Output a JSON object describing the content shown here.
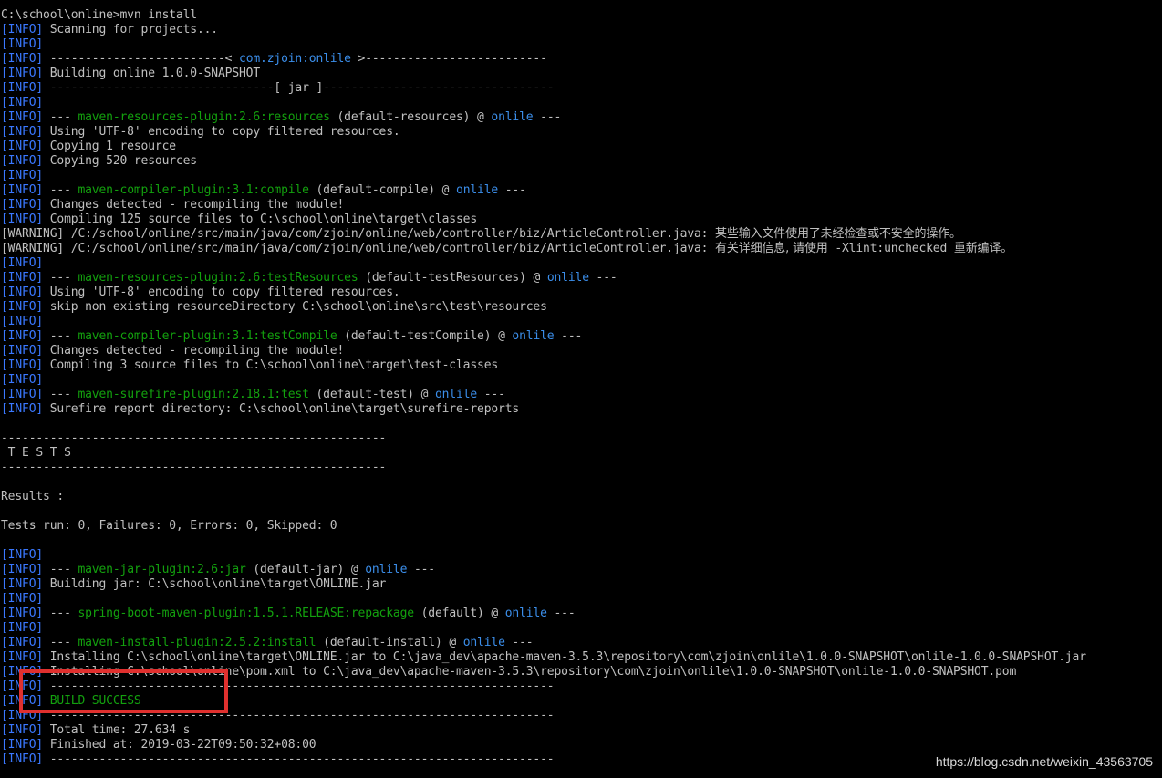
{
  "terminal": {
    "lines": [
      [
        {
          "t": "C:\\school\\online>mvn install",
          "c": "white"
        }
      ],
      [
        {
          "t": "[INFO]",
          "c": "info"
        },
        {
          "t": " Scanning for projects...",
          "c": "white"
        }
      ],
      [
        {
          "t": "[INFO]",
          "c": "info"
        }
      ],
      [
        {
          "t": "[INFO]",
          "c": "info"
        },
        {
          "t": " -------------------------< ",
          "c": "white"
        },
        {
          "t": "com.zjoin:onlile",
          "c": "blue"
        },
        {
          "t": " >--------------------------",
          "c": "white"
        }
      ],
      [
        {
          "t": "[INFO]",
          "c": "info"
        },
        {
          "t": " Building online 1.0.0-SNAPSHOT",
          "c": "white"
        }
      ],
      [
        {
          "t": "[INFO]",
          "c": "info"
        },
        {
          "t": " --------------------------------[ jar ]---------------------------------",
          "c": "white"
        }
      ],
      [
        {
          "t": "[INFO]",
          "c": "info"
        }
      ],
      [
        {
          "t": "[INFO]",
          "c": "info"
        },
        {
          "t": " --- ",
          "c": "white"
        },
        {
          "t": "maven-resources-plugin:2.6:resources",
          "c": "green"
        },
        {
          "t": " (default-resources) @ ",
          "c": "white"
        },
        {
          "t": "onlile",
          "c": "blue"
        },
        {
          "t": " ---",
          "c": "white"
        }
      ],
      [
        {
          "t": "[INFO]",
          "c": "info"
        },
        {
          "t": " Using 'UTF-8' encoding to copy filtered resources.",
          "c": "white"
        }
      ],
      [
        {
          "t": "[INFO]",
          "c": "info"
        },
        {
          "t": " Copying 1 resource",
          "c": "white"
        }
      ],
      [
        {
          "t": "[INFO]",
          "c": "info"
        },
        {
          "t": " Copying 520 resources",
          "c": "white"
        }
      ],
      [
        {
          "t": "[INFO]",
          "c": "info"
        }
      ],
      [
        {
          "t": "[INFO]",
          "c": "info"
        },
        {
          "t": " --- ",
          "c": "white"
        },
        {
          "t": "maven-compiler-plugin:3.1:compile",
          "c": "green"
        },
        {
          "t": " (default-compile) @ ",
          "c": "white"
        },
        {
          "t": "onlile",
          "c": "blue"
        },
        {
          "t": " ---",
          "c": "white"
        }
      ],
      [
        {
          "t": "[INFO]",
          "c": "info"
        },
        {
          "t": " Changes detected - recompiling the module!",
          "c": "white"
        }
      ],
      [
        {
          "t": "[INFO]",
          "c": "info"
        },
        {
          "t": " Compiling 125 source files to C:\\school\\online\\target\\classes",
          "c": "white"
        }
      ],
      [
        {
          "t": "[WARNING]",
          "c": "warn"
        },
        {
          "t": " /C:/school/online/src/main/java/com/zjoin/online/web/controller/biz/ArticleController.java: ",
          "c": "white"
        },
        {
          "t": "某些输入文件使用了未经检查或不安全的操作。",
          "c": "cjk"
        }
      ],
      [
        {
          "t": "[WARNING]",
          "c": "warn"
        },
        {
          "t": " /C:/school/online/src/main/java/com/zjoin/online/web/controller/biz/ArticleController.java: ",
          "c": "white"
        },
        {
          "t": "有关详细信息, 请使用",
          "c": "cjk"
        },
        {
          "t": " -Xlint:unchecked ",
          "c": "white"
        },
        {
          "t": "重新编译。",
          "c": "cjk"
        }
      ],
      [
        {
          "t": "[INFO]",
          "c": "info"
        }
      ],
      [
        {
          "t": "[INFO]",
          "c": "info"
        },
        {
          "t": " --- ",
          "c": "white"
        },
        {
          "t": "maven-resources-plugin:2.6:testResources",
          "c": "green"
        },
        {
          "t": " (default-testResources) @ ",
          "c": "white"
        },
        {
          "t": "onlile",
          "c": "blue"
        },
        {
          "t": " ---",
          "c": "white"
        }
      ],
      [
        {
          "t": "[INFO]",
          "c": "info"
        },
        {
          "t": " Using 'UTF-8' encoding to copy filtered resources.",
          "c": "white"
        }
      ],
      [
        {
          "t": "[INFO]",
          "c": "info"
        },
        {
          "t": " skip non existing resourceDirectory C:\\school\\online\\src\\test\\resources",
          "c": "white"
        }
      ],
      [
        {
          "t": "[INFO]",
          "c": "info"
        }
      ],
      [
        {
          "t": "[INFO]",
          "c": "info"
        },
        {
          "t": " --- ",
          "c": "white"
        },
        {
          "t": "maven-compiler-plugin:3.1:testCompile",
          "c": "green"
        },
        {
          "t": " (default-testCompile) @ ",
          "c": "white"
        },
        {
          "t": "onlile",
          "c": "blue"
        },
        {
          "t": " ---",
          "c": "white"
        }
      ],
      [
        {
          "t": "[INFO]",
          "c": "info"
        },
        {
          "t": " Changes detected - recompiling the module!",
          "c": "white"
        }
      ],
      [
        {
          "t": "[INFO]",
          "c": "info"
        },
        {
          "t": " Compiling 3 source files to C:\\school\\online\\target\\test-classes",
          "c": "white"
        }
      ],
      [
        {
          "t": "[INFO]",
          "c": "info"
        }
      ],
      [
        {
          "t": "[INFO]",
          "c": "info"
        },
        {
          "t": " --- ",
          "c": "white"
        },
        {
          "t": "maven-surefire-plugin:2.18.1:test",
          "c": "green"
        },
        {
          "t": " (default-test) @ ",
          "c": "white"
        },
        {
          "t": "onlile",
          "c": "blue"
        },
        {
          "t": " ---",
          "c": "white"
        }
      ],
      [
        {
          "t": "[INFO]",
          "c": "info"
        },
        {
          "t": " Surefire report directory: C:\\school\\online\\target\\surefire-reports",
          "c": "white"
        }
      ],
      [],
      [
        {
          "t": "-------------------------------------------------------",
          "c": "white"
        }
      ],
      [
        {
          "t": " T E S T S",
          "c": "white"
        }
      ],
      [
        {
          "t": "-------------------------------------------------------",
          "c": "white"
        }
      ],
      [],
      [
        {
          "t": "Results :",
          "c": "white"
        }
      ],
      [],
      [
        {
          "t": "Tests run: 0, Failures: 0, Errors: 0, Skipped: 0",
          "c": "white"
        }
      ],
      [],
      [
        {
          "t": "[INFO]",
          "c": "info"
        }
      ],
      [
        {
          "t": "[INFO]",
          "c": "info"
        },
        {
          "t": " --- ",
          "c": "white"
        },
        {
          "t": "maven-jar-plugin:2.6:jar",
          "c": "green"
        },
        {
          "t": " (default-jar) @ ",
          "c": "white"
        },
        {
          "t": "onlile",
          "c": "blue"
        },
        {
          "t": " ---",
          "c": "white"
        }
      ],
      [
        {
          "t": "[INFO]",
          "c": "info"
        },
        {
          "t": " Building jar: C:\\school\\online\\target\\ONLINE.jar",
          "c": "white"
        }
      ],
      [
        {
          "t": "[INFO]",
          "c": "info"
        }
      ],
      [
        {
          "t": "[INFO]",
          "c": "info"
        },
        {
          "t": " --- ",
          "c": "white"
        },
        {
          "t": "spring-boot-maven-plugin:1.5.1.RELEASE:repackage",
          "c": "green"
        },
        {
          "t": " (default) @ ",
          "c": "white"
        },
        {
          "t": "onlile",
          "c": "blue"
        },
        {
          "t": " ---",
          "c": "white"
        }
      ],
      [
        {
          "t": "[INFO]",
          "c": "info"
        }
      ],
      [
        {
          "t": "[INFO]",
          "c": "info"
        },
        {
          "t": " --- ",
          "c": "white"
        },
        {
          "t": "maven-install-plugin:2.5.2:install",
          "c": "green"
        },
        {
          "t": " (default-install) @ ",
          "c": "white"
        },
        {
          "t": "onlile",
          "c": "blue"
        },
        {
          "t": " ---",
          "c": "white"
        }
      ],
      [
        {
          "t": "[INFO]",
          "c": "info"
        },
        {
          "t": " Installing C:\\school\\online\\target\\ONLINE.jar to C:\\java_dev\\apache-maven-3.5.3\\repository\\com\\zjoin\\onlile\\1.0.0-SNAPSHOT\\onlile-1.0.0-SNAPSHOT.jar",
          "c": "white"
        }
      ],
      [
        {
          "t": "[INFO]",
          "c": "info"
        },
        {
          "t": " Installing C:\\school\\online\\pom.xml to C:\\java_dev\\apache-maven-3.5.3\\repository\\com\\zjoin\\onlile\\1.0.0-SNAPSHOT\\onlile-1.0.0-SNAPSHOT.pom",
          "c": "white"
        }
      ],
      [
        {
          "t": "[INFO]",
          "c": "info"
        },
        {
          "t": " ------------------------------------------------------------------------",
          "c": "white"
        }
      ],
      [
        {
          "t": "[INFO]",
          "c": "info"
        },
        {
          "t": " ",
          "c": "white"
        },
        {
          "t": "BUILD SUCCESS",
          "c": "green"
        }
      ],
      [
        {
          "t": "[INFO]",
          "c": "info"
        },
        {
          "t": " ------------------------------------------------------------------------",
          "c": "white"
        }
      ],
      [
        {
          "t": "[INFO]",
          "c": "info"
        },
        {
          "t": " Total time: 27.634 s",
          "c": "white"
        }
      ],
      [
        {
          "t": "[INFO]",
          "c": "info"
        },
        {
          "t": " Finished at: 2019-03-22T09:50:32+08:00",
          "c": "white"
        }
      ],
      [
        {
          "t": "[INFO]",
          "c": "info"
        },
        {
          "t": " ------------------------------------------------------------------------",
          "c": "white"
        }
      ]
    ]
  },
  "watermark": {
    "text": "https://blog.csdn.net/weixin_43563705"
  },
  "colors": {
    "background": "#000000",
    "text": "#c0c0c0",
    "info_tag": "#3a78ff",
    "plugin_green": "#13a10e",
    "artifact_blue": "#3b8eea",
    "highlight_red": "#e0302e"
  }
}
